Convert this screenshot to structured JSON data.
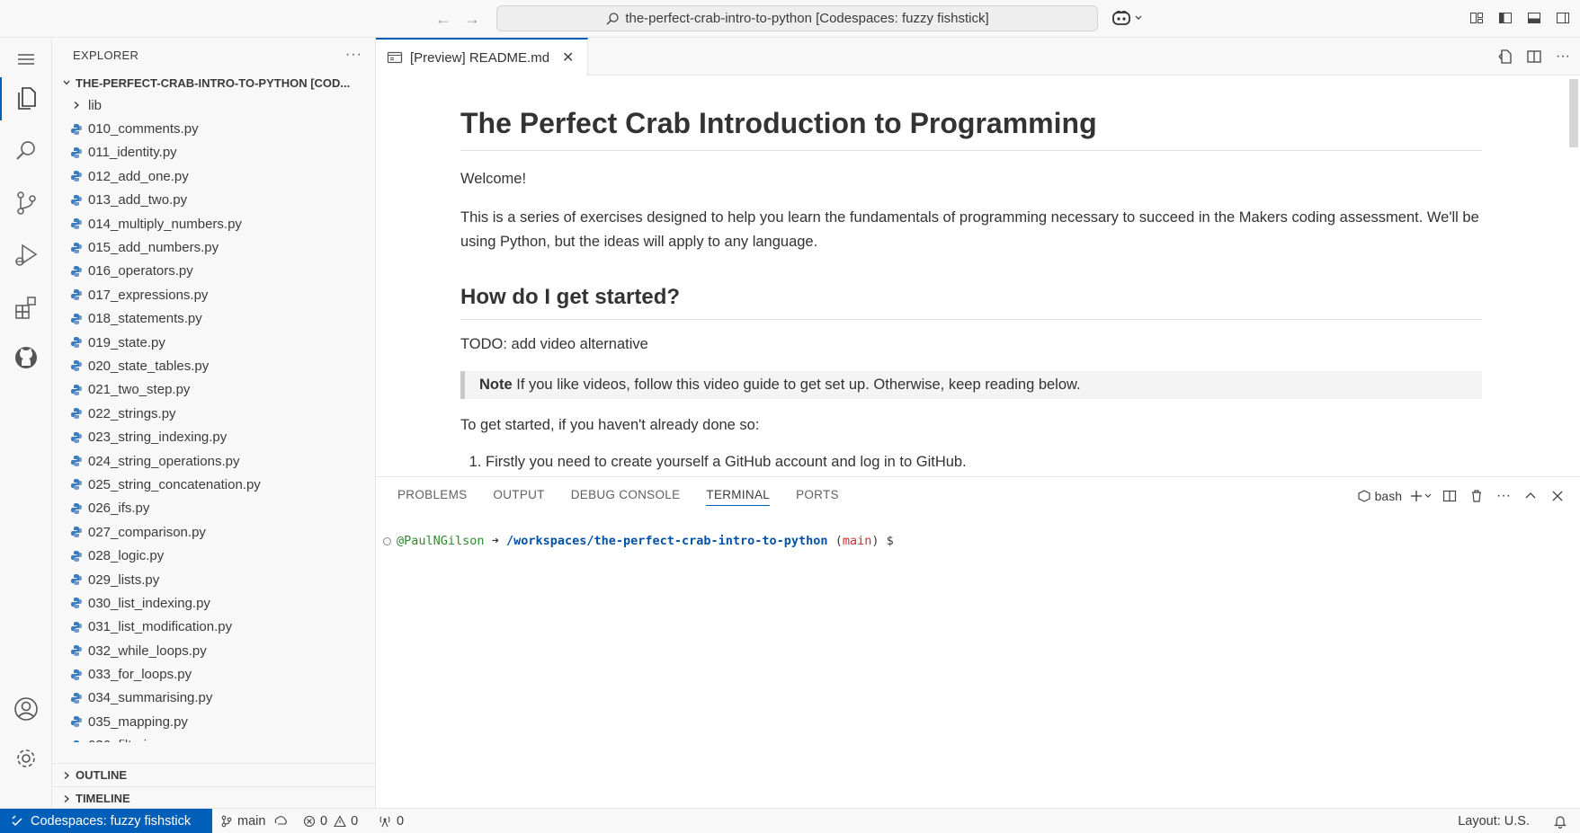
{
  "window": {
    "command_center": "the-perfect-crab-intro-to-python [Codespaces: fuzzy fishstick]"
  },
  "sidebar": {
    "title": "EXPLORER",
    "root_folder": "THE-PERFECT-CRAB-INTRO-TO-PYTHON [COD...",
    "folder": "lib",
    "files": [
      "010_comments.py",
      "011_identity.py",
      "012_add_one.py",
      "013_add_two.py",
      "014_multiply_numbers.py",
      "015_add_numbers.py",
      "016_operators.py",
      "017_expressions.py",
      "018_statements.py",
      "019_state.py",
      "020_state_tables.py",
      "021_two_step.py",
      "022_strings.py",
      "023_string_indexing.py",
      "024_string_operations.py",
      "025_string_concatenation.py",
      "026_ifs.py",
      "027_comparison.py",
      "028_logic.py",
      "029_lists.py",
      "030_list_indexing.py",
      "031_list_modification.py",
      "032_while_loops.py",
      "033_for_loops.py",
      "034_summarising.py",
      "035_mapping.py",
      "036_filtering.py"
    ],
    "sections": [
      "OUTLINE",
      "TIMELINE"
    ]
  },
  "editor": {
    "tab_label": "[Preview] README.md",
    "h1": "The Perfect Crab Introduction to Programming",
    "p_welcome": "Welcome!",
    "p_intro": "This is a series of exercises designed to help you learn the fundamentals of programming necessary to succeed in the Makers coding assessment. We'll be using Python, but the ideas will apply to any language.",
    "h2": "How do I get started?",
    "p_todo": "TODO: add video alternative",
    "note_label": "Note",
    "note_text": " If you like videos, follow this video guide to get set up. Otherwise, keep reading below.",
    "p_started": "To get started, if you haven't already done so:",
    "list_item_1": "Firstly you need to create yourself a GitHub account and log in to GitHub."
  },
  "panel": {
    "tabs": [
      "PROBLEMS",
      "OUTPUT",
      "DEBUG CONSOLE",
      "TERMINAL",
      "PORTS"
    ],
    "active_tab": "TERMINAL",
    "shell": "bash",
    "terminal": {
      "user": "@PaulNGilson",
      "arrow": " ➜ ",
      "path": "/workspaces/the-perfect-crab-intro-to-python",
      "paren_open": " (",
      "branch": "main",
      "paren_close": ")",
      "prompt": " $"
    }
  },
  "statusbar": {
    "remote": "Codespaces: fuzzy fishstick",
    "branch": "main",
    "errors": "0",
    "warnings": "0",
    "ports": "0",
    "layout": "Layout: U.S."
  },
  "colors": {
    "accent": "#005fb8",
    "python_icon": "#3b7bbf",
    "terminal_user": "#2e8b2e",
    "terminal_path": "#0451a5",
    "terminal_branch": "#cd3131"
  }
}
